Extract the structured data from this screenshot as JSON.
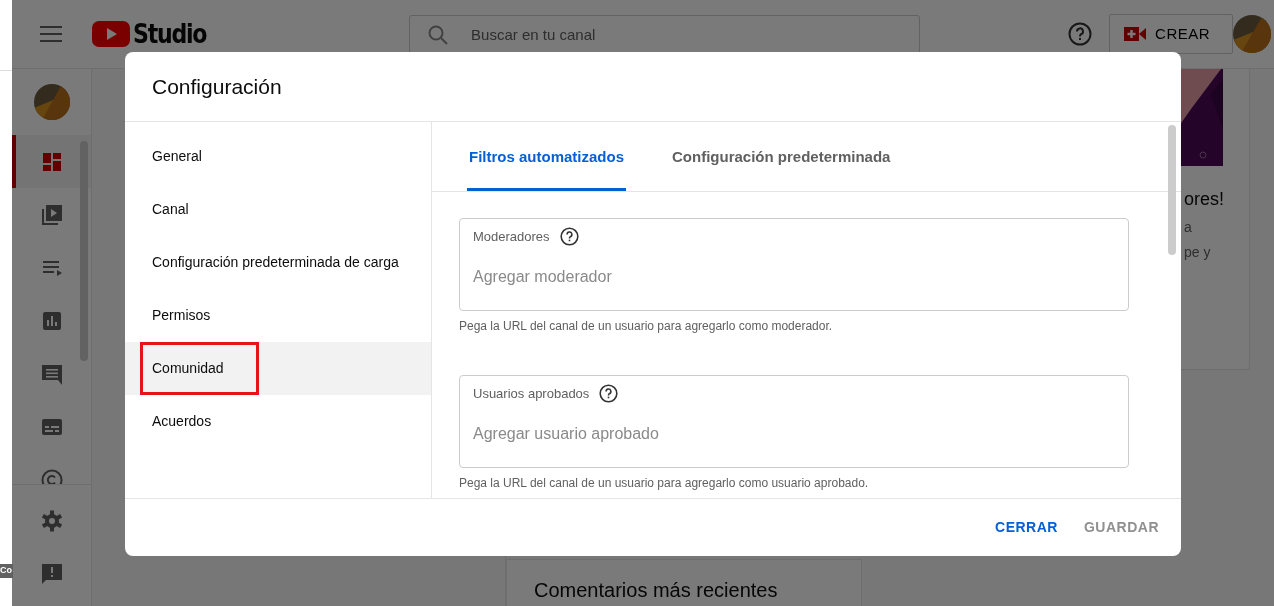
{
  "side_window": {
    "tooltip": "Co"
  },
  "app_bar": {
    "logo_text": "Studio",
    "search": {
      "placeholder": "Buscar en tu canal"
    },
    "create_button": "CREAR"
  },
  "nav_rail": [
    {
      "selected": true
    },
    {
      "selected": false
    },
    {
      "selected": false
    },
    {
      "selected": false
    },
    {
      "selected": false
    },
    {
      "selected": false
    },
    {
      "selected": false
    }
  ],
  "background": {
    "card_title": "ores!",
    "card_lines": [
      "a",
      "pe y"
    ],
    "recent_comments_title": "Comentarios más recientes"
  },
  "dialog": {
    "title": "Configuración",
    "menu": [
      {
        "label": "General",
        "selected": false,
        "highlighted": false
      },
      {
        "label": "Canal",
        "selected": false,
        "highlighted": false
      },
      {
        "label": "Configuración predeterminada de carga",
        "selected": false,
        "highlighted": false
      },
      {
        "label": "Permisos",
        "selected": false,
        "highlighted": false
      },
      {
        "label": "Comunidad",
        "selected": true,
        "highlighted": true
      },
      {
        "label": "Acuerdos",
        "selected": false,
        "highlighted": false
      }
    ],
    "tabs": [
      {
        "label": "Filtros automatizados",
        "selected": true
      },
      {
        "label": "Configuración predeterminada",
        "selected": false
      }
    ],
    "fields": [
      {
        "label": "Moderadores",
        "placeholder": "Agregar moderador",
        "helper": "Pega la URL del canal de un usuario para agregarlo como moderador."
      },
      {
        "label": "Usuarios aprobados",
        "placeholder": "Agregar usuario aprobado",
        "helper": "Pega la URL del canal de un usuario para agregarlo como usuario aprobado."
      }
    ],
    "buttons": [
      {
        "label": "CERRAR",
        "disabled": false
      },
      {
        "label": "GUARDAR",
        "disabled": true
      }
    ]
  }
}
